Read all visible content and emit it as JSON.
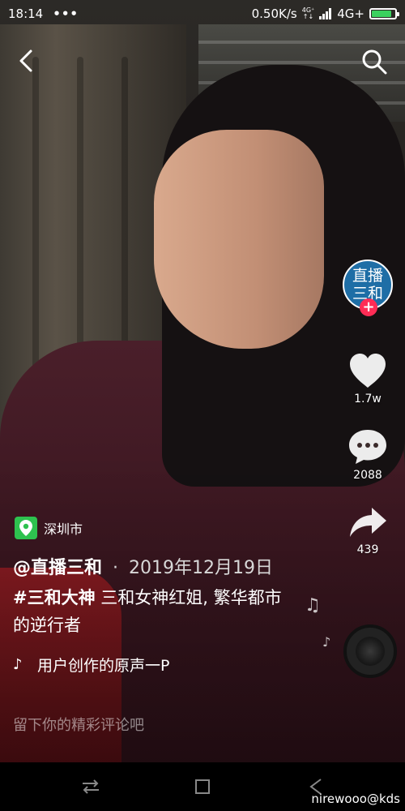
{
  "status_bar": {
    "time": "18:14",
    "dots": "•••",
    "speed": "0.50K/s",
    "net_small_top": "4G⁺",
    "net_small_bottom": "↑↓",
    "network": "4G+",
    "battery_level": 0.85,
    "battery_color": "#3bd15e"
  },
  "top": {
    "back_icon": "back-chevron-icon",
    "search_icon": "search-icon"
  },
  "author": {
    "avatar_line1": "直播",
    "avatar_line2": "三和",
    "follow_symbol": "+",
    "handle": "@直播三和",
    "separator": "·",
    "date": "2019年12月19日"
  },
  "actions": {
    "likes": "1.7w",
    "comments": "2088",
    "shares": "439"
  },
  "location": "深圳市",
  "caption": {
    "hashtag": "#三和大神",
    "text": " 三和女神红姐, 繁华都市的逆行者"
  },
  "music": {
    "note_symbol": "♪",
    "title": "用户创作的原声一P",
    "float_note_large": "♫",
    "float_note_small": "♪"
  },
  "comment_placeholder": "留下你的精彩评论吧",
  "watermark": "nirewooo@kds",
  "colors": {
    "accent_red": "#fe2c55",
    "location_green": "#2ec24f",
    "avatar_blue": "#1e6ea6"
  }
}
